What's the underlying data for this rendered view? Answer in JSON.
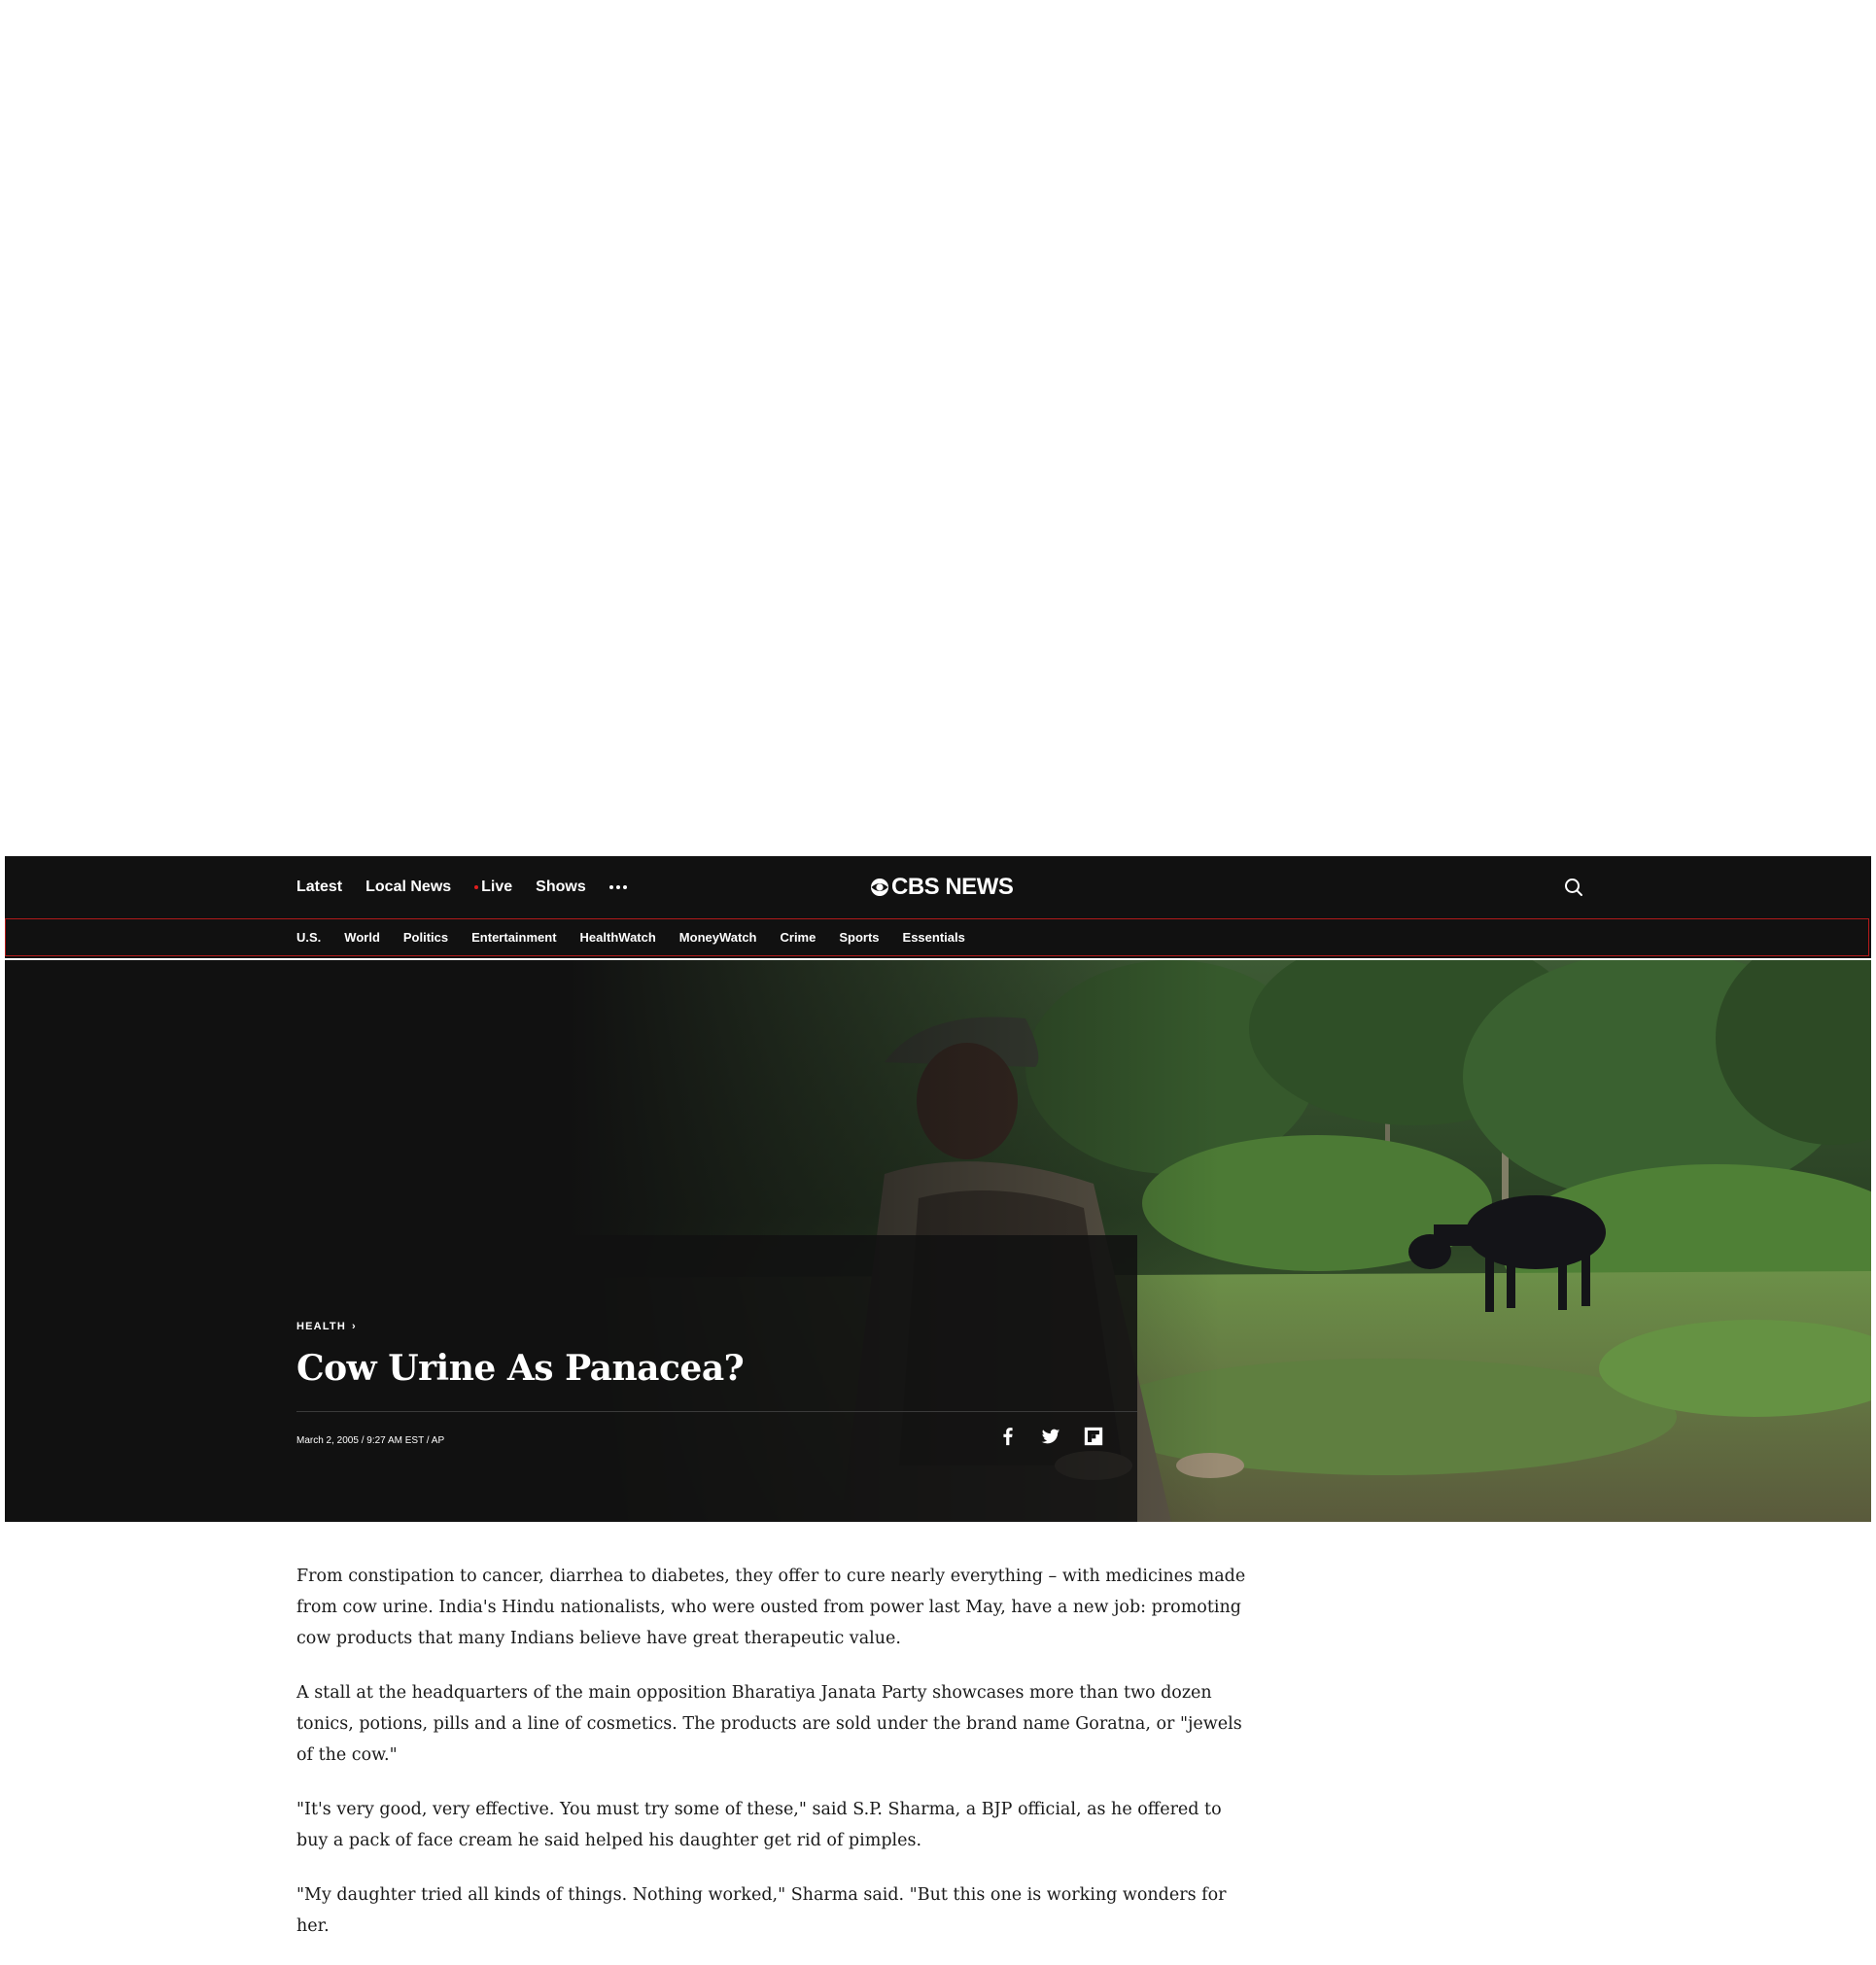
{
  "nav": {
    "latest": "Latest",
    "local_news": "Local News",
    "live": "Live",
    "shows": "Shows",
    "more_icon": "ellipsis-icon",
    "logo_text": "CBS NEWS",
    "search_icon": "search-icon"
  },
  "subnav": [
    "U.S.",
    "World",
    "Politics",
    "Entertainment",
    "HealthWatch",
    "MoneyWatch",
    "Crime",
    "Sports",
    "Essentials"
  ],
  "hero": {
    "category": "HEALTH",
    "headline": "Cow Urine As Panacea?",
    "byline": "March 2, 2005 / 9:27 AM EST / AP",
    "share_icons": [
      "facebook-icon",
      "twitter-icon",
      "flipboard-icon"
    ]
  },
  "article": {
    "paragraphs": [
      "From constipation to cancer, diarrhea to diabetes, they offer to cure nearly everything – with medicines made from cow urine. India's Hindu nationalists, who were ousted from power last May, have a new job: promoting cow products that many Indians believe have great therapeutic value.",
      "A stall at the headquarters of the main opposition Bharatiya Janata Party showcases more than two dozen tonics, potions, pills and a line of cosmetics. The products are sold under the brand name Goratna, or \"jewels of the cow.\"",
      "\"It's very good, very effective. You must try some of these,\" said S.P. Sharma, a BJP official, as he offered to buy a pack of face cream he said helped his daughter get rid of pimples.",
      "\"My daughter tried all kinds of things. Nothing worked,\" Sharma said. \"But this one is working wonders for her."
    ]
  },
  "colors": {
    "header_bg": "#111111",
    "subnav_border": "#b11a1a",
    "live_dot": "#e01e1e"
  }
}
